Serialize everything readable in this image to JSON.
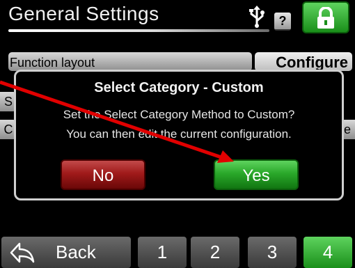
{
  "header": {
    "title": "General Settings",
    "help_label": "?",
    "usb_icon": "usb-icon",
    "lock_icon": "lock-icon"
  },
  "background_rows": [
    {
      "label": "Function layout",
      "value": "Configure"
    },
    {
      "label": "S",
      "value": ""
    },
    {
      "label": "C",
      "value": "e"
    }
  ],
  "dialog": {
    "title": "Select Category - Custom",
    "message_line1": "Set the Select Category Method to Custom?",
    "message_line2": "You can then edit the current configuration.",
    "no_label": "No",
    "yes_label": "Yes"
  },
  "footer": {
    "back_label": "Back",
    "pages": [
      "1",
      "2",
      "3",
      "4"
    ],
    "active_page": "4"
  },
  "colors": {
    "accent_green": "#2aa82a",
    "no_red": "#a01a1a",
    "annotation_arrow": "#e10000"
  }
}
